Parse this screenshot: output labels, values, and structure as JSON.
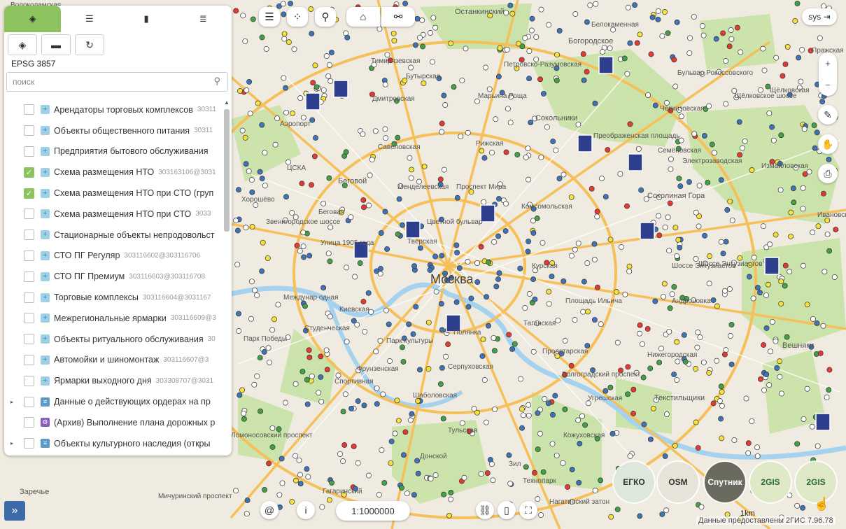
{
  "panel": {
    "tabs": [
      {
        "label": "◈",
        "icon": "layers-icon"
      },
      {
        "label": "☰",
        "icon": "legend-icon"
      },
      {
        "label": "▮",
        "icon": "book-icon"
      },
      {
        "label": "≣",
        "icon": "list-icon"
      }
    ],
    "tools": [
      {
        "icon": "layers-icon",
        "glyph": "◈"
      },
      {
        "icon": "folder-icon",
        "glyph": "▬"
      },
      {
        "icon": "refresh-icon",
        "glyph": "↻"
      }
    ],
    "projection": "EPSG 3857",
    "search_placeholder": "поиск",
    "layers": [
      {
        "name": "Арендаторы торговых комплексов",
        "code": "30311",
        "checked": false
      },
      {
        "name": "Объекты общественного питания",
        "code": "30311",
        "checked": false
      },
      {
        "name": "Предприятия бытового обслуживания",
        "code": "",
        "checked": false
      },
      {
        "name": "Схема размещения НТО",
        "code": "303163106@3031",
        "checked": true
      },
      {
        "name": "Схема размещения НТО при СТО (груп",
        "code": "",
        "checked": true
      },
      {
        "name": "Схема размещения НТО при СТО",
        "code": "3033",
        "checked": false
      },
      {
        "name": "Стационарные объекты непродовольст",
        "code": "",
        "checked": false
      },
      {
        "name": "СТО ПГ Регуляр",
        "code": "303116602@303116706",
        "checked": false
      },
      {
        "name": "СТО ПГ Премиум",
        "code": "303116603@303116708",
        "checked": false
      },
      {
        "name": "Торговые комплексы",
        "code": "303116604@3031167",
        "checked": false
      },
      {
        "name": "Межрегиональные ярмарки",
        "code": "303116609@3",
        "checked": false
      },
      {
        "name": "Объекты ритуального обслуживания",
        "code": "30",
        "checked": false
      },
      {
        "name": "Автомойки и шиномонтаж",
        "code": "303116607@3",
        "checked": false
      },
      {
        "name": "Ярмарки выходного дня",
        "code": "303308707@3031",
        "checked": false
      },
      {
        "name": "Данные о действующих ордерах на пр",
        "code": "",
        "checked": false,
        "group": true,
        "icon": "db"
      },
      {
        "name": "(Архив) Выполнение плана дорожных р",
        "code": "",
        "checked": false,
        "icon": "arch"
      },
      {
        "name": "Объекты культурного наследия (откры",
        "code": "",
        "checked": false,
        "group": true,
        "icon": "db"
      }
    ]
  },
  "user": {
    "label": "sys ⇥"
  },
  "scale": {
    "value": "1:1000000",
    "bar": "1km"
  },
  "basemaps": [
    "ЕГКО",
    "OSM",
    "Спутник",
    "2GIS",
    "2GIS"
  ],
  "credit": "Данные предоставлены 2ГИС 7.96.78",
  "map_labels": [
    "Москва",
    "Останкинский",
    "Богородское",
    "Белокаменная",
    "Сокольники",
    "Соколиная Гора",
    "Измайловская",
    "Вешняки",
    "Текстильщики",
    "Аэропорт",
    "ЦСКА",
    "Беговой",
    "Хорошёво",
    "Беговая",
    "Улица 1905 года",
    "Киевская",
    "Студенческая",
    "Парк Победы",
    "Фрунзенская",
    "Спортивная",
    "Парк культуры",
    "Полянка",
    "Серпуховская",
    "Таганская",
    "Площадь Ильича",
    "Андроновка",
    "Шоссе Энтузиастов",
    "Нижегородская",
    "Угрешская",
    "Волгоградский проспект",
    "Пролетарская",
    "Кожуховская",
    "Тульская",
    "Шаболовская",
    "Донской",
    "Гагаринский",
    "Зил",
    "Технопарк",
    "Нагатинский затон",
    "Мичуринский проспект",
    "Ломоносовский проспект",
    "Заречье",
    "Бутырская",
    "Дмитровская",
    "Савеловская",
    "Рижская",
    "Проспект Мира",
    "Комсомольская",
    "Цветной бульвар",
    "Тверская",
    "Курская",
    "Менделеевская",
    "Пражская",
    "Черкизовская",
    "Преображенская площадь",
    "Семёновская",
    "Электрозаводская",
    "Щёлковская",
    "Бульвар Рокоссовского",
    "Марьина Роща",
    "Тимирязевская",
    "Волоколамская",
    "Ивановское",
    "Междунар одная",
    "Щёлковское шоссе",
    "Звенигородское шоссе",
    "Шоссе Энтузиастов",
    "Петровско-Разумовская"
  ]
}
